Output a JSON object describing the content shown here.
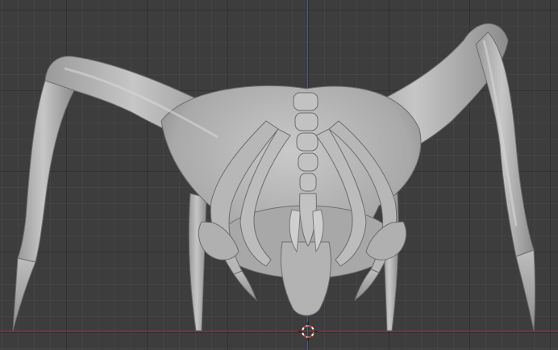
{
  "viewport": {
    "background_color": "#3d3d3d",
    "grid_color": "#2e2e2e",
    "axis_x_color": "#8a3a43",
    "axis_z_color": "#3b5e8f",
    "model_color": "#b5b5b5",
    "model_shadow_color": "#6e6e6e",
    "cursor_color_a": "#e04a2b",
    "cursor_color_b": "#ffffff"
  },
  "model": {
    "type": "sculpted creature",
    "icon": "mesh-model"
  },
  "cursor": {
    "icon": "3d-cursor-icon"
  }
}
